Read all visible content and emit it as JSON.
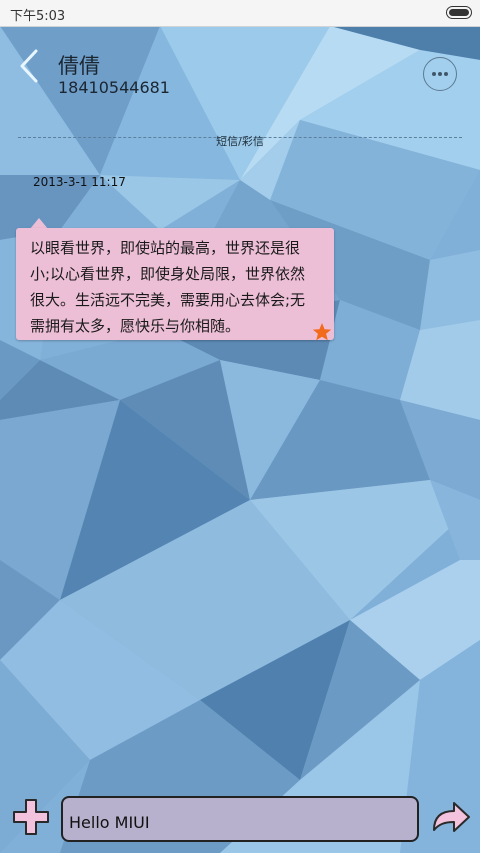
{
  "status_bar": {
    "time": "下午5:03"
  },
  "header": {
    "name": "倩倩",
    "number": "18410544681"
  },
  "divider": {
    "label": "短信/彩信"
  },
  "message": {
    "timestamp": "2013-3-1 11:17",
    "lines": [
      "以眼看世界，即使站的最高，世界还是很",
      "小;以心看世界，即使身处局限，世界依然",
      "很大。生活远不完美，需要用心去体会;无",
      "需拥有太多，愿快乐与你相随。"
    ]
  },
  "composer": {
    "text": "Hello MIUI"
  },
  "colors": {
    "bubble": "#edbfd7",
    "input_bg": "#b7b1cd",
    "accent_icon": "#f3c2dc",
    "star": "#f26a1b"
  },
  "icons": {
    "back": "chevron-left-icon",
    "more": "more-dots-icon",
    "add": "plus-icon",
    "send": "send-arrow-icon",
    "star": "star-icon",
    "battery": "battery-icon"
  }
}
